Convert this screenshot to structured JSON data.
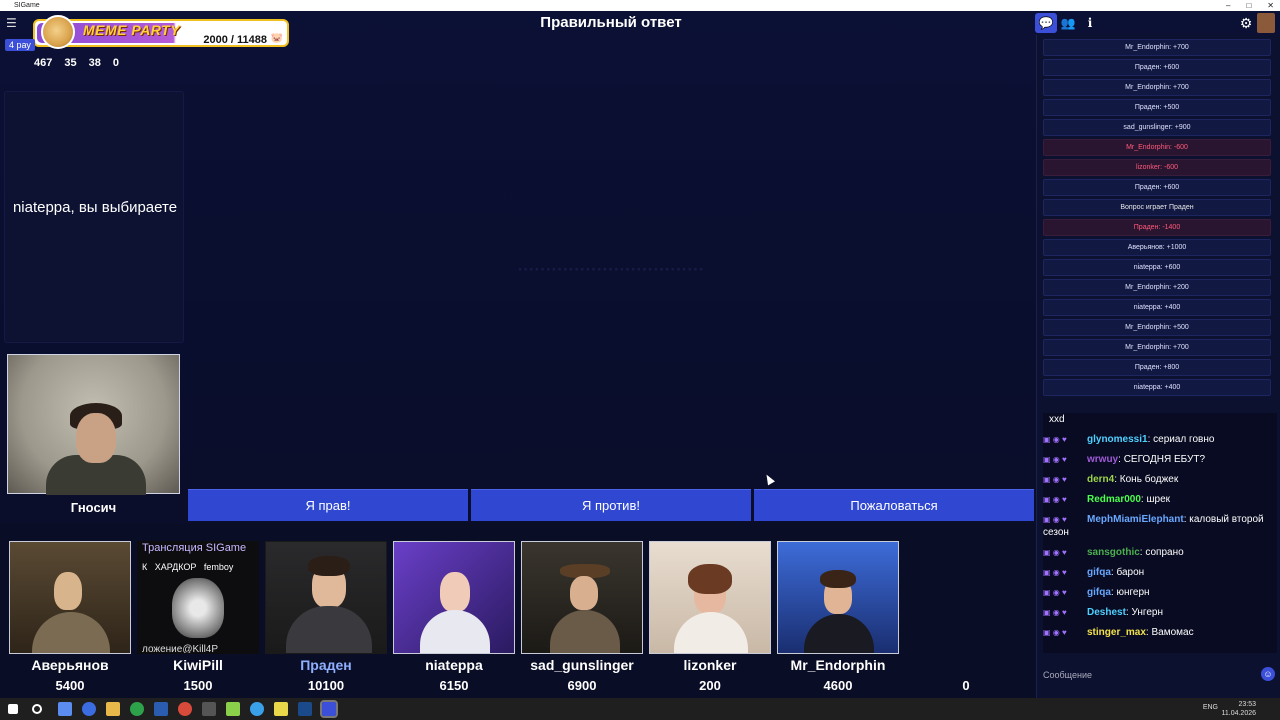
{
  "window": {
    "title": "SIGame",
    "controls": [
      "–",
      "□",
      "✕"
    ]
  },
  "topbar": {
    "round_title": "Правильный ответ",
    "menu_icon": "hamburger-menu-icon",
    "tabs": [
      {
        "icon": "chat-bubble-icon",
        "glyph": "💬",
        "active": true
      },
      {
        "icon": "users-icon",
        "glyph": "👥",
        "active": false
      },
      {
        "icon": "info-icon",
        "glyph": "i",
        "active": false
      }
    ],
    "settings_glyph": "⚙"
  },
  "overlay": {
    "title": "MEME PARTY",
    "progress": "2000 / 11488",
    "pig": "🐷",
    "rounds_tag": "4 рау",
    "stats": [
      "467",
      "35",
      "38",
      "0"
    ]
  },
  "left_panel": {
    "prompt": "niateppa, вы выбираете"
  },
  "host": {
    "name": "Гносич"
  },
  "center": {
    "ghost_text": "·································"
  },
  "actions": {
    "right": "Я прав!",
    "wrong": "Я против!",
    "complain": "Пожаловаться"
  },
  "players": [
    {
      "name": "Аверьянов",
      "score": "5400"
    },
    {
      "name": "KiwiPill",
      "score": "1500",
      "overlay_text": "Трансляция SIGame",
      "tags": "К   ХАРДКОР   femboy",
      "footer": "ложение@Kill4P"
    },
    {
      "name": "Праден",
      "score": "10100",
      "current": true
    },
    {
      "name": "niateppa",
      "score": "6150"
    },
    {
      "name": "sad_gunslinger",
      "score": "6900"
    },
    {
      "name": "lizonker",
      "score": "200"
    },
    {
      "name": "Mr_Endorphin",
      "score": "4600"
    },
    {
      "name": "",
      "score": "0"
    }
  ],
  "log": [
    {
      "text": "Mr_Endorphin: +700",
      "kind": "pos"
    },
    {
      "text": "Праден: +600",
      "kind": "pos"
    },
    {
      "text": "Mr_Endorphin: +700",
      "kind": "pos"
    },
    {
      "text": "Праден: +500",
      "kind": "pos"
    },
    {
      "text": "sad_gunslinger: +900",
      "kind": "pos"
    },
    {
      "text": "Mr_Endorphin: -600",
      "kind": "neg"
    },
    {
      "text": "lizonker: -600",
      "kind": "neg"
    },
    {
      "text": "Праден: +600",
      "kind": "pos"
    },
    {
      "text": "Вопрос играет Праден",
      "kind": "info"
    },
    {
      "text": "Праден: -1400",
      "kind": "neg"
    },
    {
      "text": "Аверьянов: +1000",
      "kind": "pos"
    },
    {
      "text": "niateppa: +600",
      "kind": "pos"
    },
    {
      "text": "Mr_Endorphin: +200",
      "kind": "pos"
    },
    {
      "text": "niateppa: +400",
      "kind": "pos"
    },
    {
      "text": "Mr_Endorphin: +500",
      "kind": "pos"
    },
    {
      "text": "Mr_Endorphin: +700",
      "kind": "pos"
    },
    {
      "text": "Праден: +800",
      "kind": "pos"
    },
    {
      "text": "niateppa: +400",
      "kind": "pos"
    }
  ],
  "chat": {
    "first_line": "xxd",
    "messages": [
      {
        "user": "glynomessi1",
        "color": "#4fd1ff",
        "text": "сериал говно"
      },
      {
        "user": "wrwuy",
        "color": "#a05ad8",
        "text": "СЕГОДНЯ ЕБУТ?"
      },
      {
        "user": "dern4",
        "color": "#9bd34a",
        "text": "Конь боджек"
      },
      {
        "user": "Redmar000",
        "color": "#4cff4c",
        "text": "шрек"
      },
      {
        "user": "MephMiamiElephant",
        "color": "#6aa8ff",
        "text": "каловый второй сезон"
      },
      {
        "user": "sansgothic",
        "color": "#4caf50",
        "text": "сопрано"
      },
      {
        "user": "gifqa",
        "color": "#6aa8ff",
        "text": "барон"
      },
      {
        "user": "gifqa",
        "color": "#6aa8ff",
        "text": "юнгерн"
      },
      {
        "user": "Deshest",
        "color": "#4fd1ff",
        "text": "Унгерн"
      },
      {
        "user": "stinger_max",
        "color": "#f2e14c",
        "text": "Вамомас"
      }
    ],
    "input_placeholder": "Сообщение"
  },
  "taskbar": {
    "lang": "ENG",
    "time": "23:53",
    "date": "11.04.2026"
  }
}
